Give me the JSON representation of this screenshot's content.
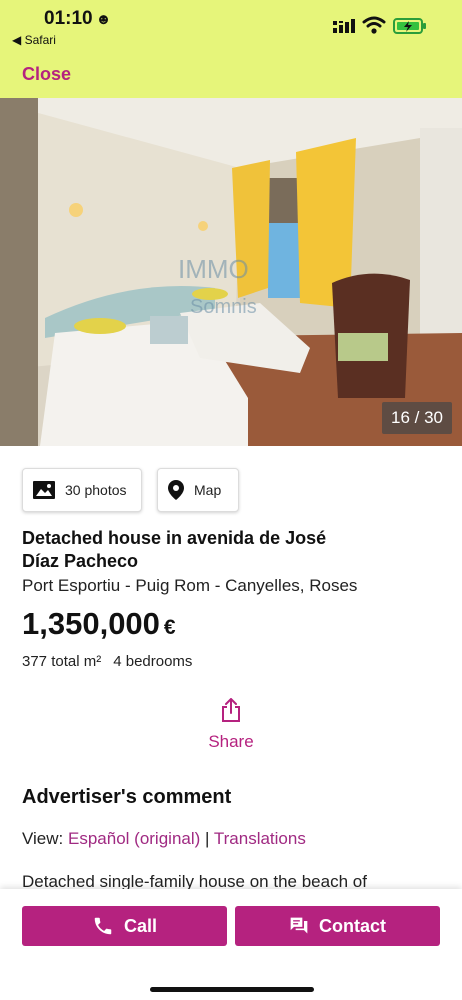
{
  "status_bar": {
    "time": "01:10",
    "emoji": "☻",
    "back_app": "◀ Safari"
  },
  "header": {
    "close_label": "Close"
  },
  "gallery": {
    "counter": "16 / 30",
    "watermark": "Somnis"
  },
  "actions": {
    "photos_label": "30 photos",
    "map_label": "Map"
  },
  "listing": {
    "title_line1": "Detached house in avenida de José",
    "title_line2": "Díaz Pacheco",
    "location": "Port Esportiu - Puig Rom - Canyelles, Roses",
    "price": "1,350,000",
    "currency": "€",
    "area": "377 total m²",
    "bedrooms": "4 bedrooms"
  },
  "share": {
    "label": "Share"
  },
  "comment": {
    "heading": "Advertiser's comment",
    "view_prefix": "View:",
    "original_link": "Español (original)",
    "separator": "|",
    "translations_link": "Translations",
    "text_start": "Detached single-family house on the beach of"
  },
  "bottom_bar": {
    "call_label": "Call",
    "contact_label": "Contact"
  },
  "colors": {
    "accent": "#b5227f",
    "header_bg": "#e6f57a"
  }
}
